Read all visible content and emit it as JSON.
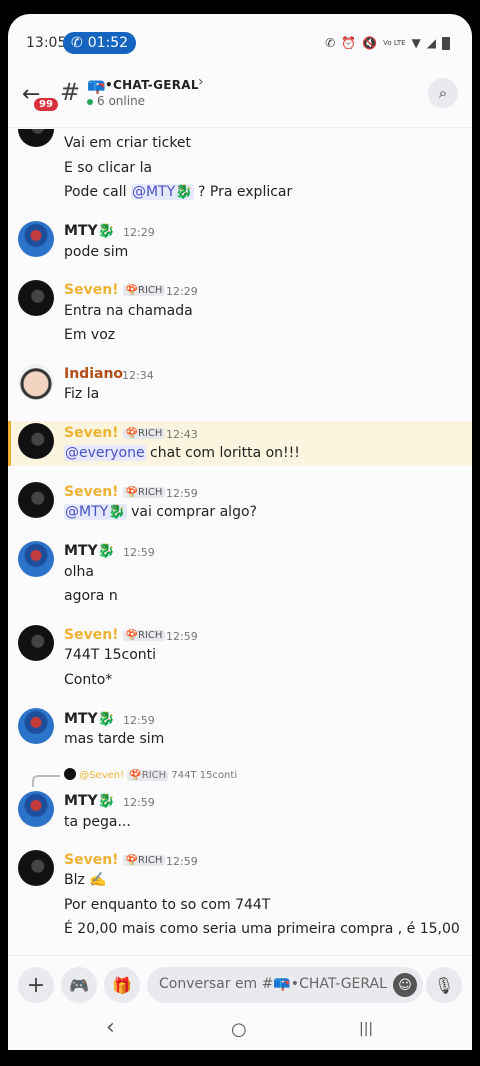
{
  "status_bar": {
    "time": "13:05",
    "call_timer": "01:52",
    "icons": [
      "call-icon",
      "alarm-icon",
      "mute-icon",
      "volte-icon",
      "wifi-icon",
      "signal-icon",
      "battery-icon"
    ],
    "volte": "Vo LTE"
  },
  "header": {
    "back_icon": "arrow-left-icon",
    "unread_badge": "99",
    "hash": "#",
    "channel_emoji": "📪",
    "channel_name": "•CHAT-GERAL",
    "chevron": "›",
    "online": "6 online",
    "search_icon": "search-icon"
  },
  "messages": [
    {
      "id": "m0",
      "lines": [
        "Vai em criar ticket",
        "E so clicar la"
      ]
    },
    {
      "id": "m0b",
      "pre": "Pode call ",
      "mention": "@MTY🐉",
      "post": " ? Pra explicar"
    },
    {
      "id": "m1",
      "author": "MTY🐉",
      "time": "12:29",
      "lines": [
        "pode sim"
      ]
    },
    {
      "id": "m2",
      "author": "Seven!",
      "tag": "🍄RICH",
      "time": "12:29",
      "lines": [
        "Entra na chamada",
        "Em voz"
      ]
    },
    {
      "id": "m3",
      "author": "Indiano",
      "time": "12:34",
      "lines": [
        "Fiz la"
      ]
    },
    {
      "id": "m4",
      "author": "Seven!",
      "tag": "🍄RICH",
      "time": "12:43",
      "mention": "@everyone",
      "post": " chat com loritta on!!!"
    },
    {
      "id": "m5",
      "author": "Seven!",
      "tag": "🍄RICH",
      "time": "12:59",
      "mention": "@MTY🐉",
      "post": " vai comprar algo?"
    },
    {
      "id": "m6",
      "author": "MTY🐉",
      "time": "12:59",
      "lines": [
        "olha",
        "agora n"
      ]
    },
    {
      "id": "m7",
      "author": "Seven!",
      "tag": "🍄RICH",
      "time": "12:59",
      "lines": [
        "744T 15conti",
        "Conto*"
      ]
    },
    {
      "id": "m8",
      "author": "MTY🐉",
      "time": "12:59",
      "lines": [
        "mas tarde sim"
      ]
    },
    {
      "id": "m9",
      "reply_author": "@Seven!",
      "reply_tag": "🍄RICH",
      "reply_text": "744T 15conti",
      "author": "MTY🐉",
      "time": "12:59",
      "lines": [
        "ta pega..."
      ]
    },
    {
      "id": "m10",
      "author": "Seven!",
      "tag": "🍄RICH",
      "time": "12:59",
      "lines": [
        "Blz ✍️",
        "Por enquanto to so com 744T",
        "É 20,00 mais como seria uma primeira compra , é 15,00"
      ]
    }
  ],
  "input_bar": {
    "plus": "+",
    "gamepad_icon": "gamepad-icon",
    "gift_icon": "gift-icon",
    "placeholder": "Conversar em #📪•CHAT-GERAL",
    "emoji_icon": "smile-icon",
    "mic_icon": "microphone-icon"
  },
  "nav_bar": {
    "back": "‹",
    "home": "○",
    "recents": "|||"
  }
}
